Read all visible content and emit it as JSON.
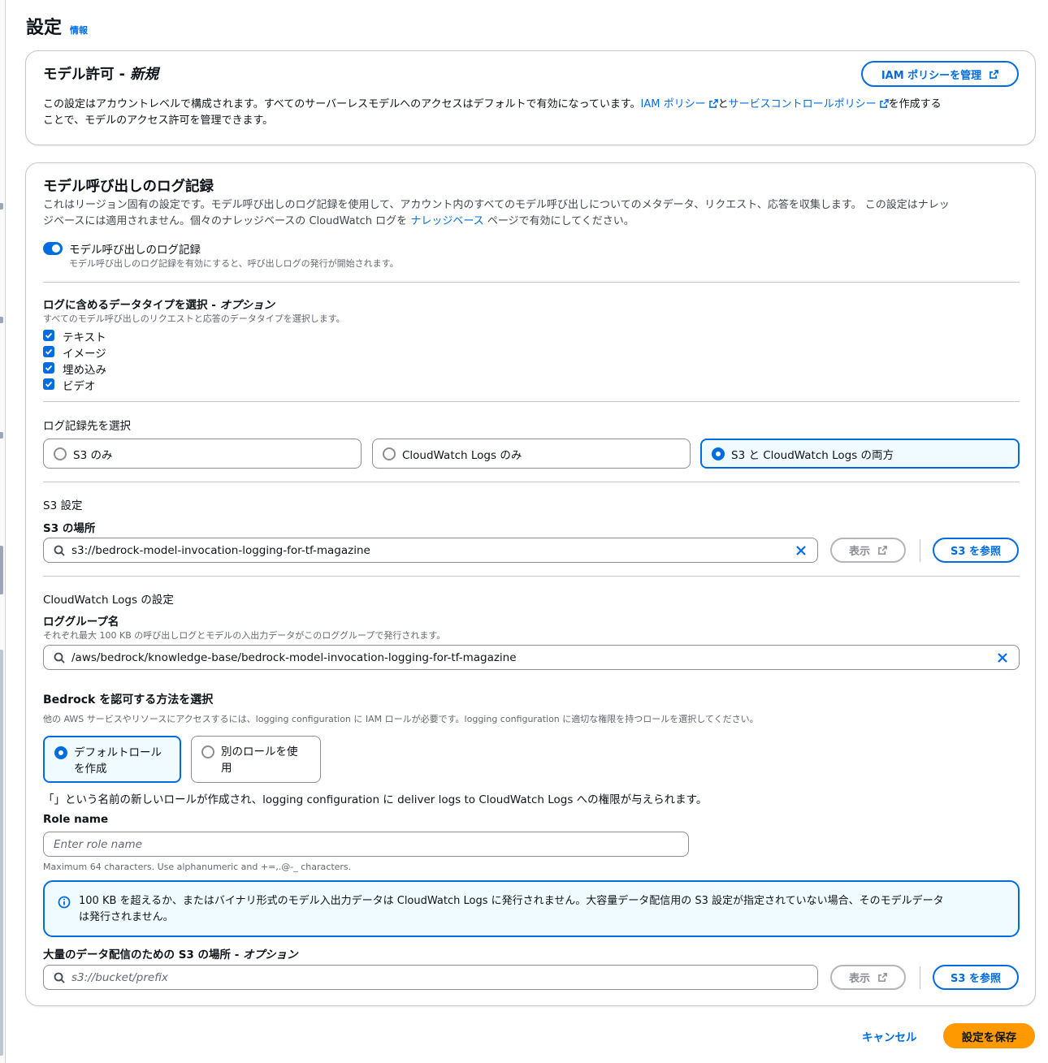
{
  "page": {
    "title": "設定",
    "info": "情報"
  },
  "access": {
    "title": "モデル許可 - ",
    "title_em": "新規",
    "manage_button": "IAM ポリシーを管理",
    "desc_1": "この設定はアカウントレベルで構成されます。すべてのサーバーレスモデルへのアクセスはデフォルトで有効になっています。",
    "iam_link": "IAM ポリシー",
    "desc_2": "と",
    "scp_link": "サービスコントロールポリシー",
    "desc_3": "を作成する",
    "desc_4": "ことで、モデルのアクセス許可を管理できます。"
  },
  "logging": {
    "title": "モデル呼び出しのログ記録",
    "desc_1": "これはリージョン固有の設定です。モデル呼び出しのログ記録を使用して、アカウント内のすべてのモデル呼び出しについてのメタデータ、リクエスト、応答を収集します。 この設定はナレッ",
    "desc_2a": "ジベースには適用されません。個々のナレッジベースの CloudWatch ログを ",
    "kb_link": "ナレッジベース",
    "desc_2b": " ページで有効にしてください。",
    "toggle_label": "モデル呼び出しのログ記録",
    "toggle_on": true,
    "toggle_desc": "モデル呼び出しのログ記録を有効にすると、呼び出しログの発行が開始されます。",
    "datatypes_label": "ログに含めるデータタイプを選択 - ",
    "datatypes_label_em": "オプション",
    "datatypes_desc": "すべてのモデル呼び出しのリクエストと応答のデータタイプを選択します。",
    "datatypes": [
      {
        "label": "テキスト",
        "checked": true
      },
      {
        "label": "イメージ",
        "checked": true
      },
      {
        "label": "埋め込み",
        "checked": true
      },
      {
        "label": "ビデオ",
        "checked": true
      }
    ],
    "dest_label": "ログ記録先を選択",
    "destinations": [
      {
        "label": "S3 のみ",
        "selected": false
      },
      {
        "label": "CloudWatch Logs のみ",
        "selected": false
      },
      {
        "label": "S3 と CloudWatch Logs の両方",
        "selected": true
      }
    ],
    "s3_settings": "S3 設定",
    "s3_location_label": "S3 の場所",
    "s3_location_value": "s3://bedrock-model-invocation-logging-for-tf-magazine",
    "view_button": "表示",
    "browse_s3_button": "S3 を参照",
    "cw_settings": "CloudWatch Logs の設定",
    "log_group_label": "ロググループ名",
    "log_group_desc": "それぞれ最大 100 KB の呼び出しログとモデルの入出力データがこのロググループで発行されます。",
    "log_group_value": "/aws/bedrock/knowledge-base/bedrock-model-invocation-logging-for-tf-magazine",
    "auth_label": "Bedrock を認可する方法を選択",
    "auth_desc": "他の AWS サービスやリソースにアクセスするには、logging configuration に IAM ロールが必要です。logging configuration に適切な権限を持つロールを選択してください。",
    "auth_options": [
      {
        "line1": "デフォルトロール",
        "line2": "を作成",
        "selected": true
      },
      {
        "line1": "別のロールを使",
        "line2": "用",
        "selected": false
      }
    ],
    "role_note": "「」という名前の新しいロールが作成され、logging configuration に deliver logs to CloudWatch Logs への権限が与えられます。",
    "role_name_label": "Role name",
    "role_name_placeholder": "Enter role name",
    "role_name_hint": "Maximum 64 characters. Use alphanumeric and +=,.@-_ characters.",
    "alert_1": "100 KB を超えるか、またはバイナリ形式のモデル入出力データは CloudWatch Logs に発行されません。大容量データ配信用の S3 設定が指定されていない場合、そのモデルデータ",
    "alert_2": "は発行されません。",
    "large_s3_label": "大量のデータ配信のための S3 の場所 - ",
    "large_s3_label_em": "オプション",
    "large_s3_placeholder": "s3://bucket/prefix"
  },
  "footer": {
    "cancel": "キャンセル",
    "save": "設定を保存"
  },
  "colors": {
    "accent": "#006ce0",
    "primary_button": "#ff9900",
    "border": "#c6c6cd"
  }
}
